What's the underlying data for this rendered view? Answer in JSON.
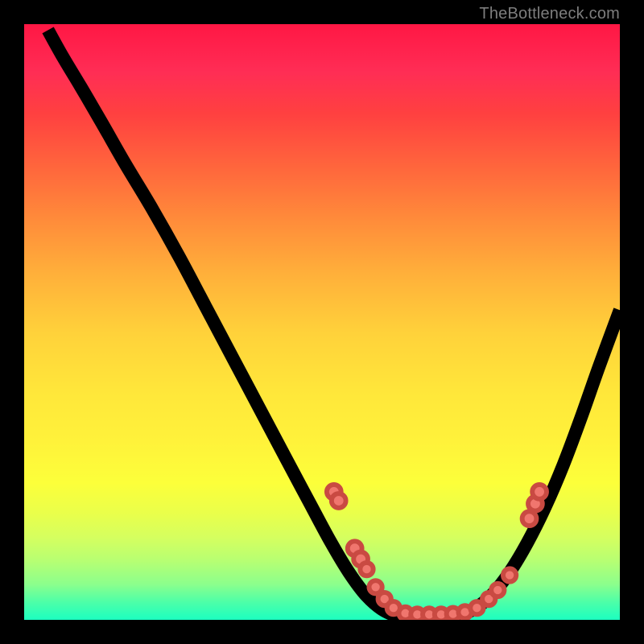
{
  "watermark": "TheBottleneck.com",
  "chart_data": {
    "type": "line",
    "title": "",
    "xlabel": "",
    "ylabel": "",
    "xlim": [
      0,
      100
    ],
    "ylim": [
      0,
      100
    ],
    "description": "V-shaped bottleneck curve over a vertical red-to-green gradient. Higher y = worse (red), lower y = better (green). Pink dots mark sampled points near the valley floor.",
    "curve": {
      "name": "bottleneck",
      "points": [
        {
          "x": 4.0,
          "y": 99.0
        },
        {
          "x": 6.5,
          "y": 94.5
        },
        {
          "x": 9.5,
          "y": 89.5
        },
        {
          "x": 13.0,
          "y": 83.5
        },
        {
          "x": 17.0,
          "y": 76.5
        },
        {
          "x": 21.5,
          "y": 69.0
        },
        {
          "x": 26.0,
          "y": 61.0
        },
        {
          "x": 30.5,
          "y": 52.5
        },
        {
          "x": 35.0,
          "y": 44.0
        },
        {
          "x": 39.5,
          "y": 35.5
        },
        {
          "x": 44.0,
          "y": 27.0
        },
        {
          "x": 48.0,
          "y": 19.5
        },
        {
          "x": 51.5,
          "y": 13.0
        },
        {
          "x": 54.5,
          "y": 8.0
        },
        {
          "x": 57.5,
          "y": 4.0
        },
        {
          "x": 60.5,
          "y": 1.5
        },
        {
          "x": 63.5,
          "y": 0.5
        },
        {
          "x": 66.5,
          "y": 0.3
        },
        {
          "x": 69.5,
          "y": 0.3
        },
        {
          "x": 72.5,
          "y": 0.6
        },
        {
          "x": 75.5,
          "y": 1.8
        },
        {
          "x": 78.5,
          "y": 4.2
        },
        {
          "x": 81.5,
          "y": 8.0
        },
        {
          "x": 84.5,
          "y": 13.0
        },
        {
          "x": 87.5,
          "y": 19.0
        },
        {
          "x": 90.5,
          "y": 26.0
        },
        {
          "x": 93.5,
          "y": 34.0
        },
        {
          "x": 96.5,
          "y": 42.5
        },
        {
          "x": 100.0,
          "y": 52.0
        }
      ]
    },
    "dots": [
      {
        "x": 52.0,
        "y": 21.5,
        "r": 1.2
      },
      {
        "x": 52.8,
        "y": 20.0,
        "r": 1.2
      },
      {
        "x": 55.5,
        "y": 12.0,
        "r": 1.2
      },
      {
        "x": 56.5,
        "y": 10.2,
        "r": 1.2
      },
      {
        "x": 57.5,
        "y": 8.5,
        "r": 1.1
      },
      {
        "x": 59.0,
        "y": 5.5,
        "r": 1.1
      },
      {
        "x": 60.5,
        "y": 3.5,
        "r": 1.1
      },
      {
        "x": 62.0,
        "y": 2.0,
        "r": 1.1
      },
      {
        "x": 64.0,
        "y": 1.1,
        "r": 1.1
      },
      {
        "x": 66.0,
        "y": 0.9,
        "r": 1.1
      },
      {
        "x": 68.0,
        "y": 0.9,
        "r": 1.1
      },
      {
        "x": 70.0,
        "y": 0.9,
        "r": 1.1
      },
      {
        "x": 72.0,
        "y": 1.0,
        "r": 1.1
      },
      {
        "x": 74.0,
        "y": 1.3,
        "r": 1.1
      },
      {
        "x": 76.0,
        "y": 2.0,
        "r": 1.1
      },
      {
        "x": 78.0,
        "y": 3.5,
        "r": 1.1
      },
      {
        "x": 79.5,
        "y": 5.0,
        "r": 1.1
      },
      {
        "x": 81.5,
        "y": 7.5,
        "r": 1.1
      },
      {
        "x": 84.8,
        "y": 17.0,
        "r": 1.2
      },
      {
        "x": 85.8,
        "y": 19.5,
        "r": 1.2
      },
      {
        "x": 86.5,
        "y": 21.5,
        "r": 1.2
      }
    ]
  }
}
